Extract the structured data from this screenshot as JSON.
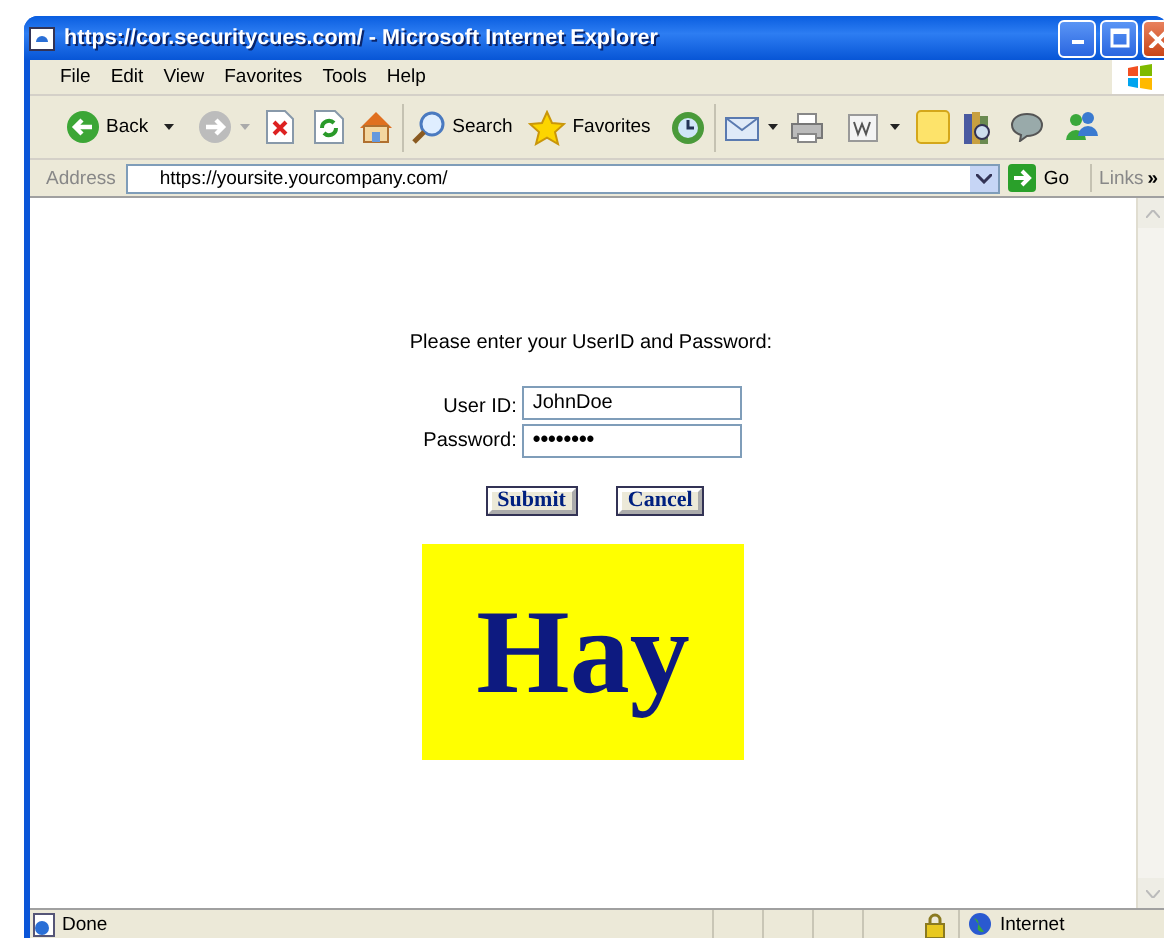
{
  "window": {
    "title": "https://cor.securitycues.com/ - Microsoft Internet Explorer"
  },
  "menu": [
    "File",
    "Edit",
    "View",
    "Favorites",
    "Tools",
    "Help"
  ],
  "toolbar": {
    "back": "Back",
    "search": "Search",
    "favorites": "Favorites"
  },
  "address_bar": {
    "label": "Address",
    "value": "https://yoursite.yourcompany.com/",
    "go": "Go",
    "links": "Links",
    "more": "»"
  },
  "page": {
    "prompt": "Please enter your UserID and Password:",
    "fields": [
      {
        "label": "User ID:",
        "value": "JohnDoe",
        "kind": "text"
      },
      {
        "label": "Password:",
        "value": "••••••••",
        "kind": "password"
      }
    ],
    "buttons": [
      "Submit",
      "Cancel"
    ],
    "banner": "Hay"
  },
  "status_bar": {
    "text": "Done",
    "zone": "Internet"
  }
}
